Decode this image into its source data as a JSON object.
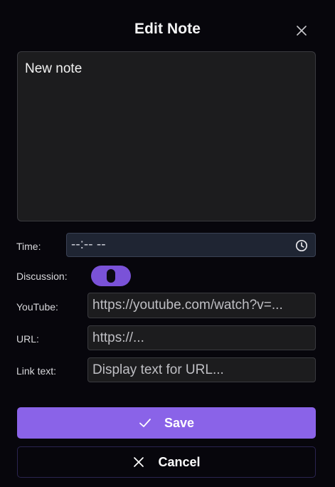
{
  "dialog": {
    "title": "Edit Note",
    "close_icon": "close-icon"
  },
  "note": {
    "value": "New note"
  },
  "form": {
    "time": {
      "label": "Time:",
      "value": "--:-- --",
      "icon": "clock-icon"
    },
    "discussion": {
      "label": "Discussion:",
      "enabled": true
    },
    "youtube": {
      "label": "YouTube:",
      "placeholder": "https://youtube.com/watch?v=..."
    },
    "url": {
      "label": "URL:",
      "placeholder": "https://..."
    },
    "link_text": {
      "label": "Link text:",
      "placeholder": "Display text for URL..."
    }
  },
  "actions": {
    "save_label": "Save",
    "save_icon": "check-icon",
    "cancel_label": "Cancel",
    "cancel_icon": "close-icon"
  },
  "colors": {
    "background": "#07060c",
    "accent": "#8a63e8",
    "toggle": "#7a52d8",
    "field_bg": "#1c1c1e",
    "time_field_bg": "#1f2533"
  }
}
